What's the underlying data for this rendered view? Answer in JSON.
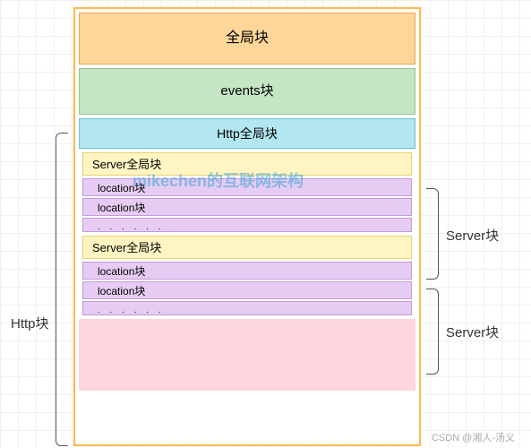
{
  "blocks": {
    "global": "全局块",
    "events": "events块",
    "http_global": "Http全局块",
    "server1": {
      "header": "Server全局块",
      "loc1": "location块",
      "loc2": "location块",
      "dots": ". . . . . ."
    },
    "server2": {
      "header": "Server全局块",
      "loc1": "location块",
      "loc2": "location块",
      "dots": ". . . . . ."
    }
  },
  "labels": {
    "http": "Http块",
    "server": "Server块"
  },
  "watermark": "mikechen的互联网架构",
  "footer": "CSDN @湘人-汤义"
}
